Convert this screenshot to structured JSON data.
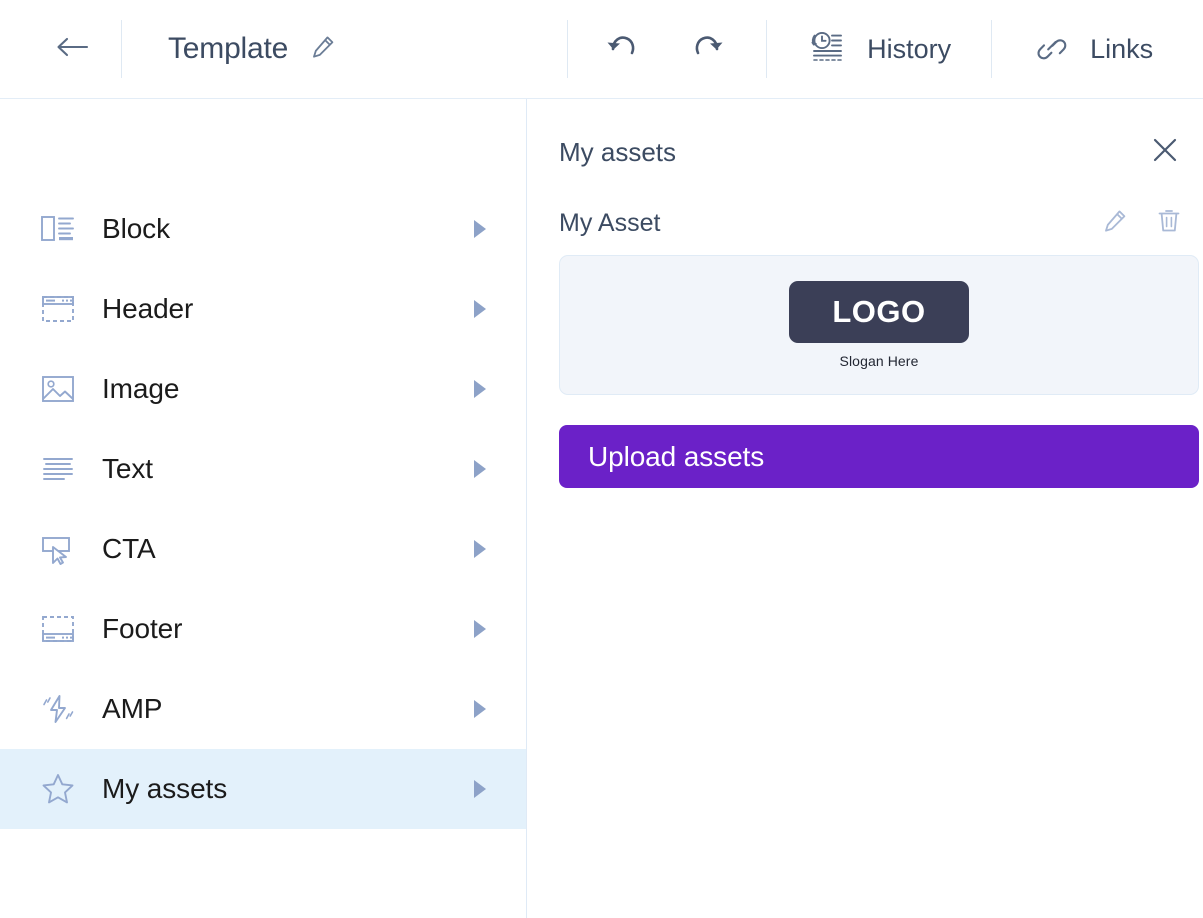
{
  "header": {
    "back_icon": "arrow-left-icon",
    "title": "Template",
    "title_edit_icon": "pencil-icon",
    "undo_icon": "undo-arrow-icon",
    "redo_icon": "redo-arrow-icon",
    "history_icon": "clock-history-icon",
    "history_label": "History",
    "links_icon": "chain-link-icon",
    "links_label": "Links"
  },
  "sidebar": {
    "items": [
      {
        "label": "Block",
        "icon": "block-layout-icon",
        "active": false
      },
      {
        "label": "Header",
        "icon": "header-layout-icon",
        "active": false
      },
      {
        "label": "Image",
        "icon": "image-icon",
        "active": false
      },
      {
        "label": "Text",
        "icon": "text-lines-icon",
        "active": false
      },
      {
        "label": "CTA",
        "icon": "cta-cursor-icon",
        "active": false
      },
      {
        "label": "Footer",
        "icon": "footer-layout-icon",
        "active": false
      },
      {
        "label": "AMP",
        "icon": "amp-bolt-icon",
        "active": false
      },
      {
        "label": "My assets",
        "icon": "star-icon",
        "active": true
      }
    ],
    "chevron_icon": "chevron-right-icon"
  },
  "panel": {
    "title": "My assets",
    "close_icon": "close-x-icon",
    "asset": {
      "name": "My Asset",
      "edit_icon": "pencil-icon",
      "delete_icon": "trash-icon",
      "preview": {
        "logo_text": "LOGO",
        "slogan": "Slogan Here"
      }
    },
    "upload_button_label": "Upload assets"
  },
  "colors": {
    "accent_purple": "#6B21C8",
    "active_row": "#e3f1fb",
    "icon_blue": "#8da2c8",
    "text_dark": "#3c4b62",
    "logo_navy": "#3b3f57",
    "card_bg": "#f2f5fa"
  }
}
